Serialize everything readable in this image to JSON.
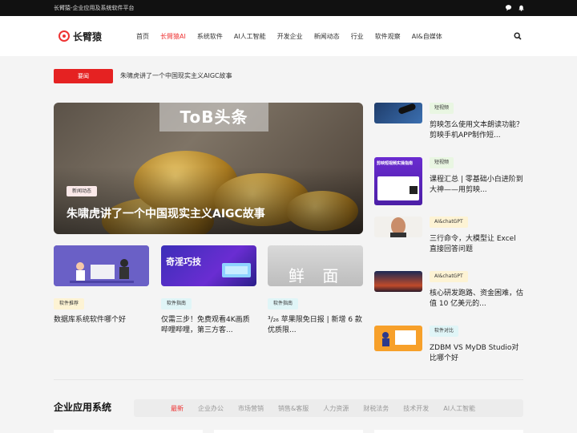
{
  "topbar": {
    "site_name": "长臂猿-企业应用及系统软件平台",
    "icons": [
      "chat-icon",
      "bell-icon"
    ]
  },
  "header": {
    "logo_text": "长臂猿",
    "nav": [
      {
        "label": "首页",
        "active": false
      },
      {
        "label": "长臂猿AI",
        "active": true
      },
      {
        "label": "系统软件",
        "active": false
      },
      {
        "label": "AI人工智能",
        "active": false
      },
      {
        "label": "开发企业",
        "active": false
      },
      {
        "label": "新闻动态",
        "active": false
      },
      {
        "label": "行业",
        "active": false
      },
      {
        "label": "软件观察",
        "active": false
      },
      {
        "label": "AI&自媒体",
        "active": false
      }
    ]
  },
  "notice": {
    "badge": "要闻",
    "text": "朱啸虎讲了一个中国现实主义AIGC故事"
  },
  "hero": {
    "banner": "ToB头条",
    "tag": "新闻动态",
    "title": "朱啸虎讲了一个中国现实主义AIGC故事"
  },
  "cards": [
    {
      "tag": "软件推荐",
      "title": "数据库系统软件哪个好"
    },
    {
      "tag": "软件指南",
      "title": "仅需三步！免费观看4K画质哔哩哔哩，第三方客..."
    },
    {
      "tag": "软件指南",
      "title": "³/₂₆ 苹果限免日报 | 新增 6 款优质限..."
    }
  ],
  "card_images": {
    "card2_text": "奇淫巧技",
    "card3_text": "鲜 面"
  },
  "side": [
    {
      "tag": "短视频",
      "title": "剪映怎么使用文本朗读功能？剪映手机APP制作短..."
    },
    {
      "tag": "短视频",
      "title": "课程汇总 | 零基础小白进阶到大神——用剪映..."
    },
    {
      "tag": "AI&chatGPT",
      "title": "三行命令，大模型让 Excel 直接回答问题"
    },
    {
      "tag": "AI&chatGPT",
      "title": "核心研发跑路、资金困难，估值 10 亿美元的..."
    },
    {
      "tag": "软件对比",
      "title": "ZDBM VS MyDB Studio对比哪个好"
    }
  ],
  "side_images": {
    "item2_text": "剪映短视频实操指南"
  },
  "section": {
    "title": "企业应用系统",
    "tabs": [
      {
        "label": "最新",
        "active": true
      },
      {
        "label": "企业办公",
        "active": false
      },
      {
        "label": "市场营销",
        "active": false
      },
      {
        "label": "销售&客服",
        "active": false
      },
      {
        "label": "人力资源",
        "active": false
      },
      {
        "label": "财税法务",
        "active": false
      },
      {
        "label": "技术开发",
        "active": false
      },
      {
        "label": "AI人工智能",
        "active": false
      }
    ]
  },
  "colors": {
    "accent": "#e33333",
    "notice_bg": "#e52222",
    "tag_pink": "#fbe9e9",
    "tag_yellow": "#fdf3d4",
    "tag_cyan": "#e0f5f7",
    "tag_green": "#e9f6e2"
  }
}
